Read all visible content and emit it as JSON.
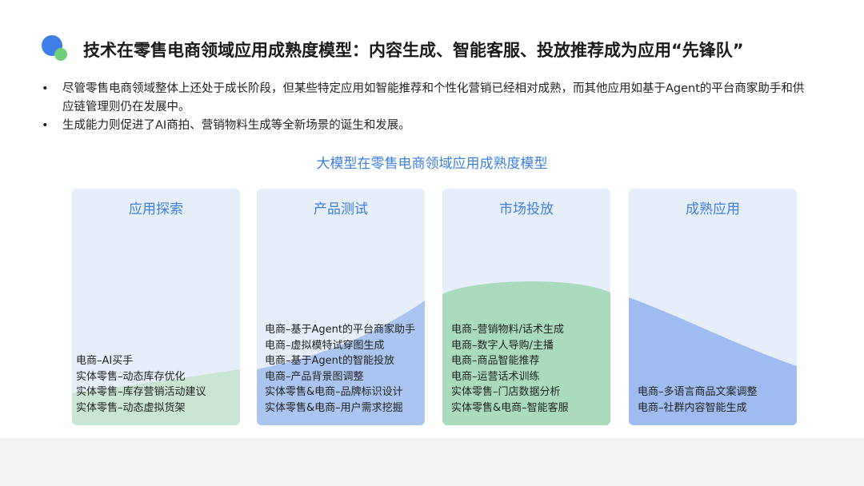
{
  "header": {
    "title": "技术在零售电商领域应用成熟度模型：内容生成、智能客服、投放推荐成为应用“先锋队”"
  },
  "bullets": [
    "尽管零售电商领域整体上还处于成长阶段，但某些特定应用如智能推荐和个性化营销已经相对成熟，而其他应用如基于Agent的平台商家助手和供应链管理则仍在发展中。",
    "生成能力则促进了AI商拍、营销物料生成等全新场景的诞生和发展。"
  ],
  "diagram": {
    "title": "大模型在零售电商领域应用成熟度模型",
    "stages": [
      {
        "title": "应用探索",
        "items": [
          "电商–AI买手",
          "实体零售–动态库存优化",
          "实体零售–库存营销活动建议",
          "实体零售–动态虚拟货架"
        ]
      },
      {
        "title": "产品测试",
        "items": [
          "电商–基于Agent的平台商家助手",
          "电商–虚拟模特试穿图生成",
          "电商–基于Agent的智能投放",
          "电商–产品背景图调整",
          "实体零售&电商–品牌标识设计",
          "实体零售&电商–用户需求挖掘"
        ]
      },
      {
        "title": "市场投放",
        "items": [
          "电商–营销物料/话术生成",
          "电商–数字人导购/主播",
          "电商–商品智能推荐",
          "电商–运营话术训练",
          "实体零售–门店数据分析",
          "实体零售&电商–智能客服"
        ]
      },
      {
        "title": "成熟应用",
        "items": [
          "电商–多语言商品文案调整",
          "电商–社群内容智能生成"
        ]
      }
    ]
  },
  "colors": {
    "accent_blue": "#3e7fe0",
    "panel_bg": "#e6eef9",
    "green_fill": "#c8e6d3",
    "green_dark_fill": "#a6dcb9",
    "blue_fill": "#a9c3f1",
    "blue_dark_fill": "#8eb0ee"
  }
}
